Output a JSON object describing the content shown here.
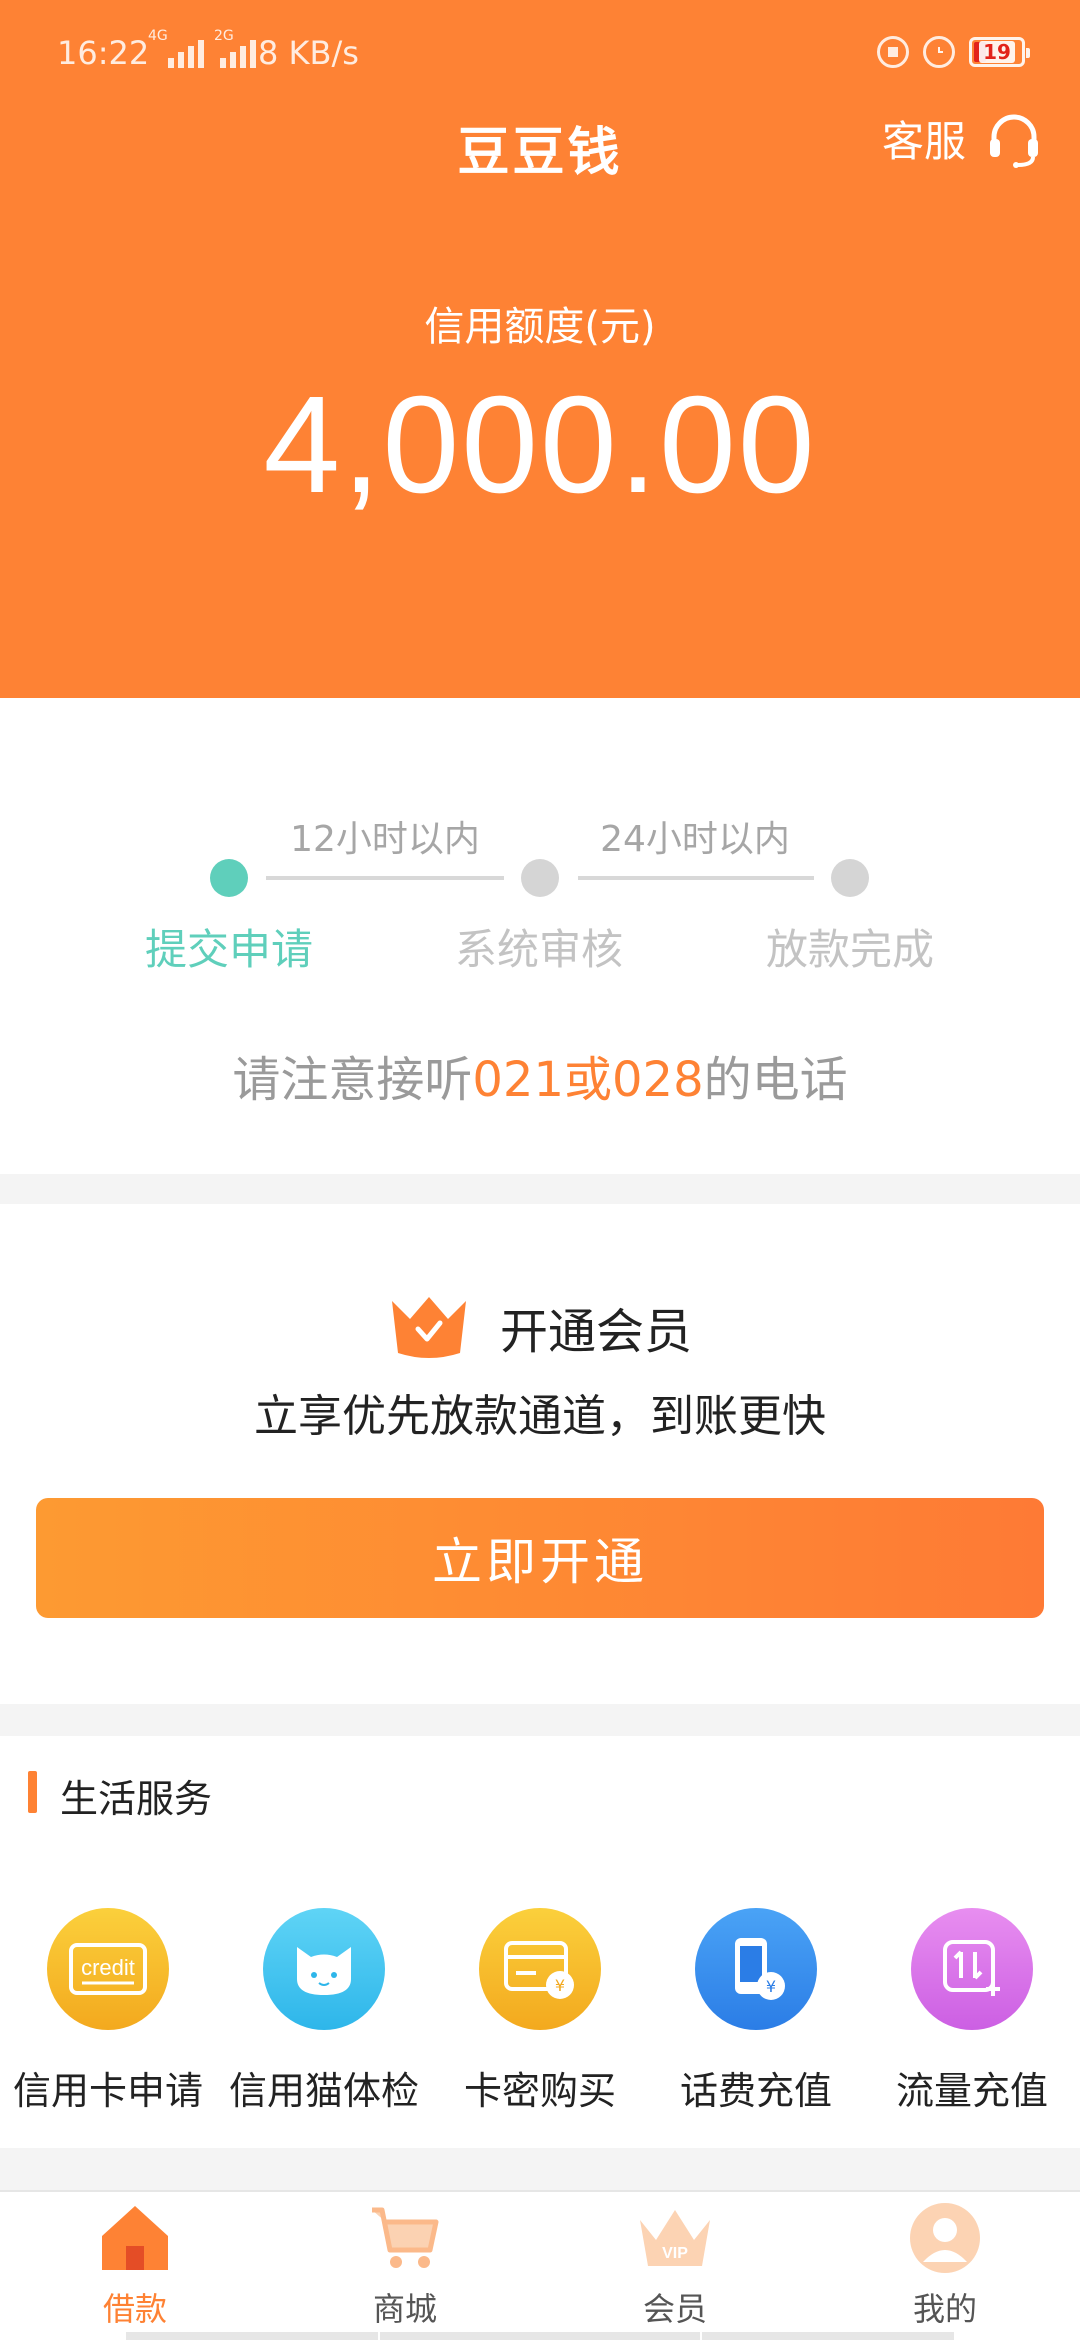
{
  "status_bar": {
    "time": "16:22",
    "net1": "4G",
    "net2": "2G",
    "speed": "8 KB/s",
    "battery": "19",
    "icons": [
      "signal-icon",
      "rotation-lock-icon",
      "alarm-icon",
      "battery-icon"
    ]
  },
  "header": {
    "title": "豆豆钱",
    "customer_service": "客服",
    "credit_label": "信用额度(元)",
    "credit_amount": "4,000.00"
  },
  "progress": {
    "time_labels": [
      "12小时以内",
      "24小时以内"
    ],
    "steps": [
      {
        "label": "提交申请",
        "active": true
      },
      {
        "label": "系统审核",
        "active": false
      },
      {
        "label": "放款完成",
        "active": false
      }
    ],
    "notice_pre": "请注意接听",
    "notice_highlight": "021或028",
    "notice_post": "的电话"
  },
  "membership": {
    "title": "开通会员",
    "subtitle": "立享优先放款通道，到账更快",
    "button": "立即开通"
  },
  "life_services": {
    "title": "生活服务",
    "items": [
      {
        "label": "信用卡申请",
        "icon": "credit-card-icon",
        "icon_text": "credit"
      },
      {
        "label": "信用猫体检",
        "icon": "cat-icon"
      },
      {
        "label": "卡密购买",
        "icon": "card-purchase-icon"
      },
      {
        "label": "话费充值",
        "icon": "phone-recharge-icon"
      },
      {
        "label": "流量充值",
        "icon": "data-recharge-icon"
      }
    ]
  },
  "bottom_nav": {
    "items": [
      {
        "label": "借款",
        "icon": "home-icon",
        "active": true
      },
      {
        "label": "商城",
        "icon": "cart-icon",
        "active": false
      },
      {
        "label": "会员",
        "icon": "vip-crown-icon",
        "active": false,
        "icon_text": "VIP"
      },
      {
        "label": "我的",
        "icon": "user-icon",
        "active": false
      }
    ]
  },
  "colors": {
    "brand_orange": "#fe8234",
    "step_active": "#5fcfbb",
    "step_inactive": "#d5d5d5"
  }
}
